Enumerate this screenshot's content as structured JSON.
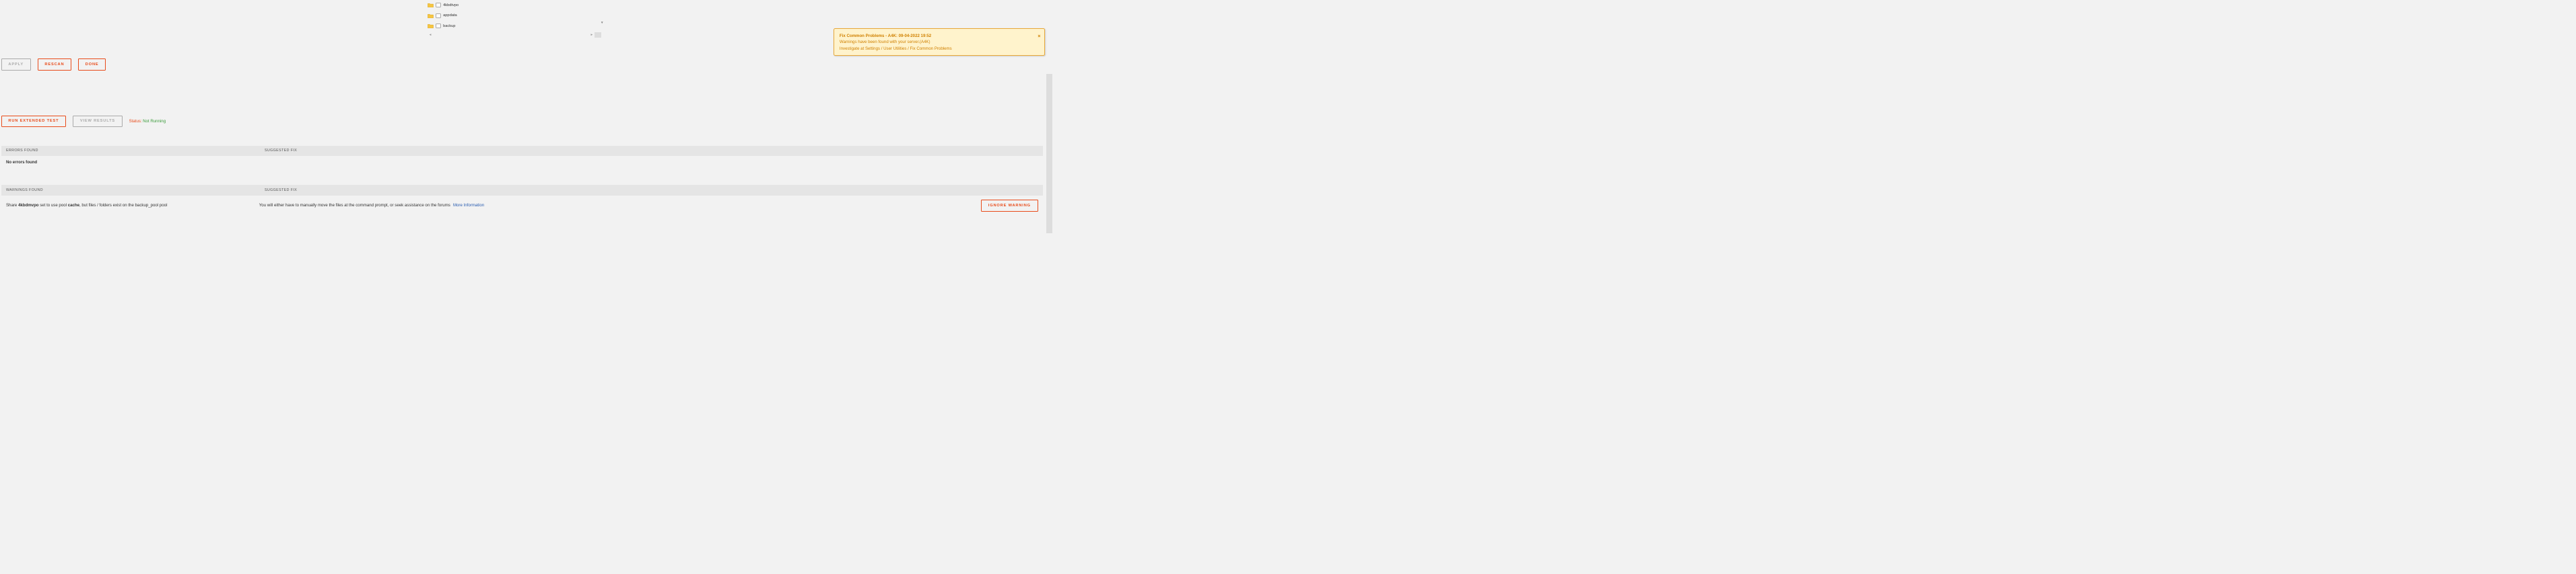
{
  "tree": {
    "items": [
      {
        "label": "4kbdtvpo"
      },
      {
        "label": "appdata"
      },
      {
        "label": "backup"
      }
    ],
    "dropdown_glyph": "▼",
    "scroll_left_glyph": "◂",
    "scroll_right_glyph": "▸"
  },
  "buttons": {
    "apply": "Apply",
    "rescan": "Rescan",
    "done": "Done",
    "run_extended": "Run Extended Test",
    "view_results": "View Results",
    "ignore_warning": "Ignore Warning"
  },
  "status": {
    "label": "Status:",
    "value": "Not Running"
  },
  "errors": {
    "header_left": "ERRORS FOUND",
    "header_right": "SUGGESTED FIX",
    "none": "No errors found"
  },
  "warnings": {
    "header_left": "WARNINGS FOUND",
    "header_right": "SUGGESTED FIX",
    "row": {
      "pre": "Share ",
      "share": "4kbdmvpo",
      "mid": " set to use pool ",
      "pool": "cache",
      "post": ", but files / folders exist on the backup_pool pool",
      "fix": "You will either have to manually move the files at the command prompt, or seek assistance on the forums",
      "more": "More Information"
    }
  },
  "notification": {
    "title": "Fix Common Problems - A4K: 09-04-2022 19:52",
    "line2": "Warnings have been found with your server.(A4K)",
    "line3": "Investigate at Settings / User Utilities / Fix Common Problems",
    "close_glyph": "×"
  }
}
